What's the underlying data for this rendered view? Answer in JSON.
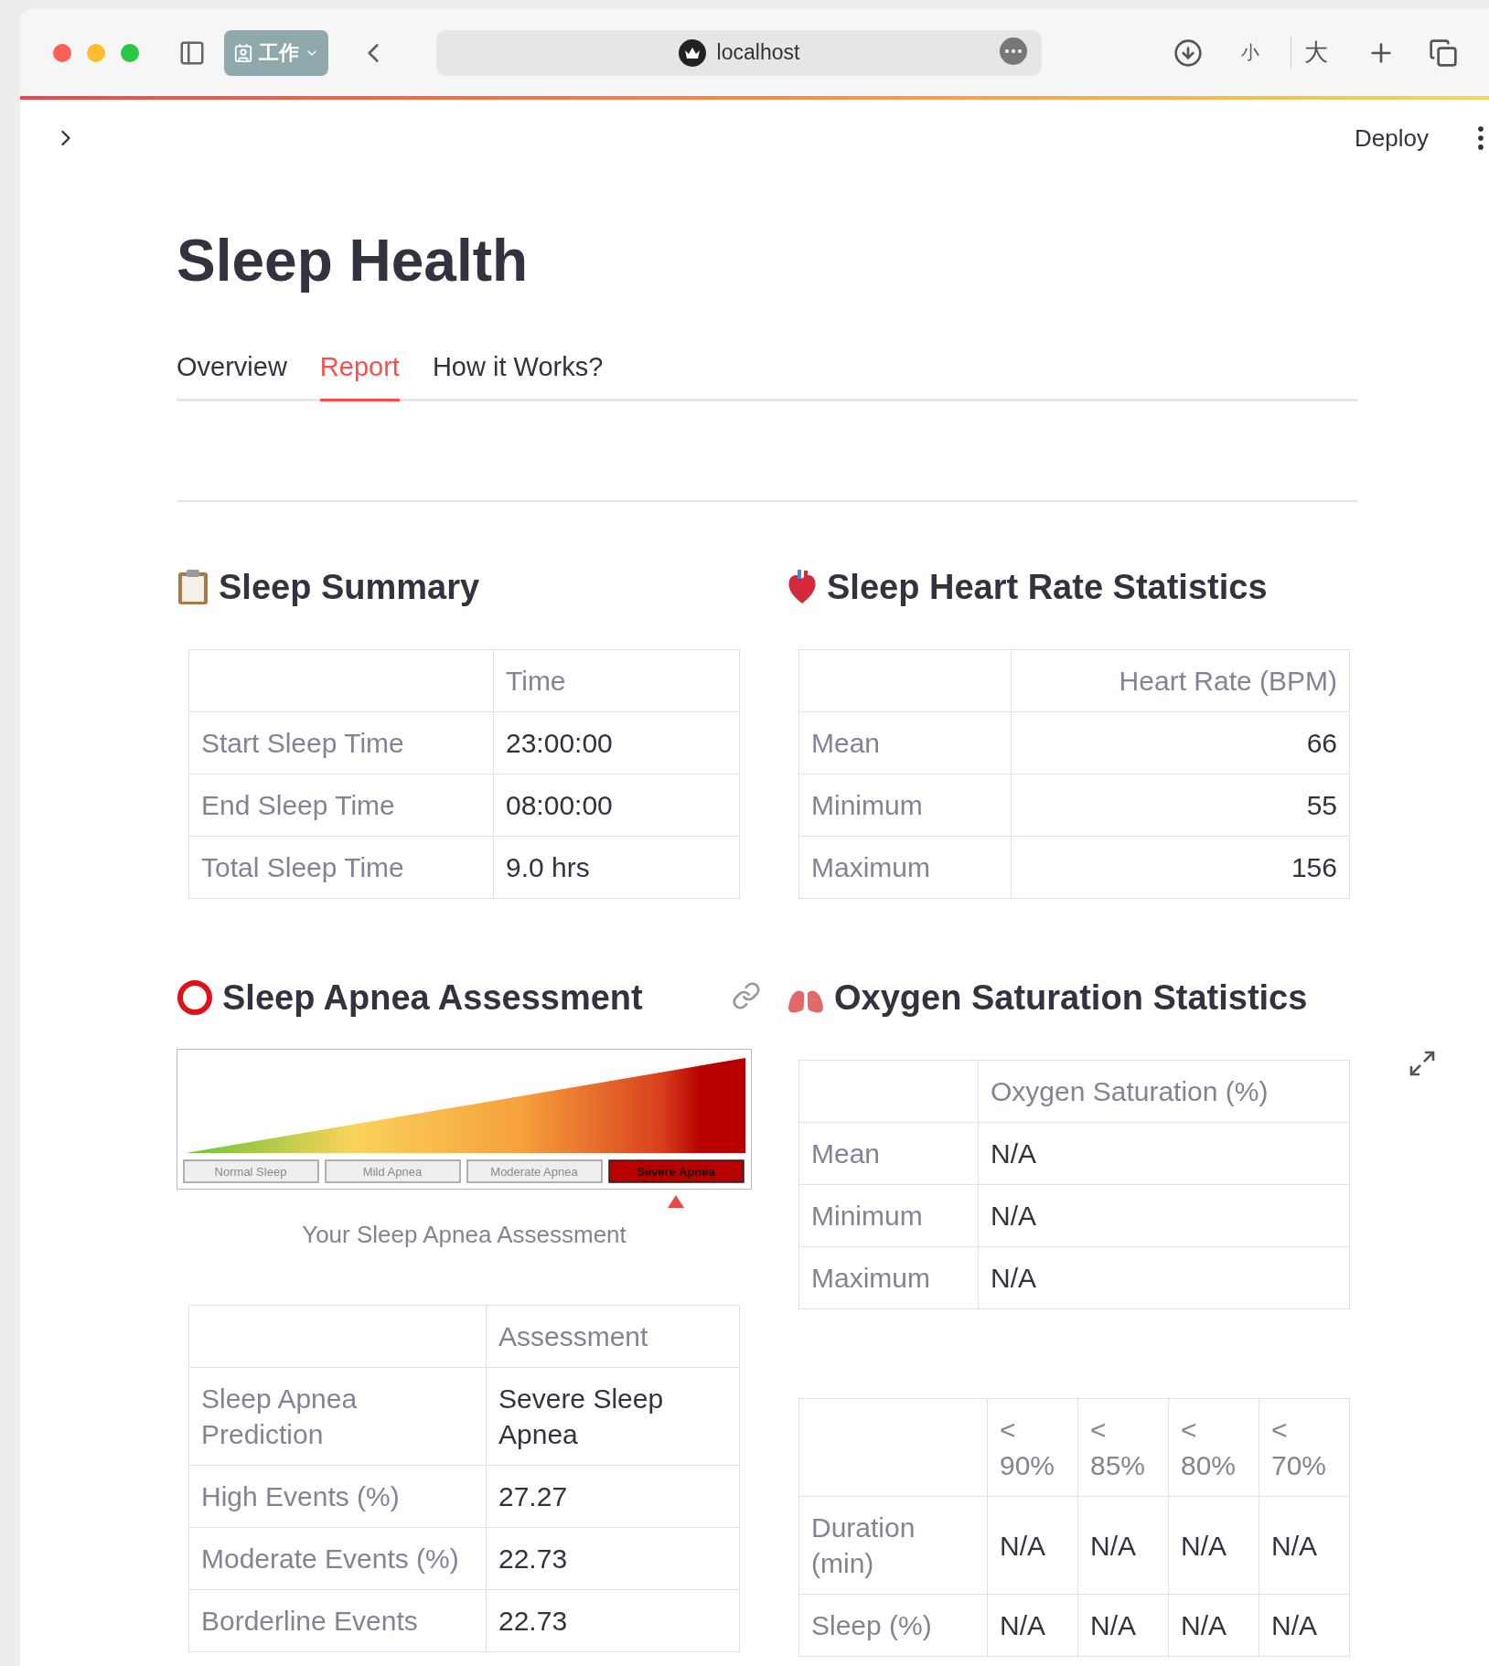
{
  "browser": {
    "tab_group": "工作",
    "address": "localhost",
    "text_smaller": "小",
    "text_larger": "大"
  },
  "header": {
    "deploy": "Deploy"
  },
  "title": "Sleep Health",
  "tabs": [
    {
      "label": "Overview",
      "selected": false
    },
    {
      "label": "Report",
      "selected": true
    },
    {
      "label": "How it Works?",
      "selected": false
    }
  ],
  "sleep_summary": {
    "title": "Sleep Summary",
    "columns": [
      "Time"
    ],
    "rows": [
      {
        "label": "Start Sleep Time",
        "values": [
          "23:00:00"
        ]
      },
      {
        "label": "End Sleep Time",
        "values": [
          "08:00:00"
        ]
      },
      {
        "label": "Total Sleep Time",
        "values": [
          "9.0 hrs"
        ]
      }
    ]
  },
  "heart_rate": {
    "title": "Sleep Heart Rate Statistics",
    "columns": [
      "Heart Rate (BPM)"
    ],
    "rows": [
      {
        "label": "Mean",
        "values": [
          "66"
        ]
      },
      {
        "label": "Minimum",
        "values": [
          "55"
        ]
      },
      {
        "label": "Maximum",
        "values": [
          "156"
        ]
      }
    ]
  },
  "apnea": {
    "title": "Sleep Apnea Assessment",
    "gauge": {
      "levels": [
        {
          "label": "Normal Sleep",
          "selected": false
        },
        {
          "label": "Mild Apnea",
          "selected": false
        },
        {
          "label": "Moderate Apnea",
          "selected": false
        },
        {
          "label": "Severe Apnea",
          "selected": true
        }
      ]
    },
    "caption": "Your Sleep Apnea Assessment",
    "columns": [
      "Assessment"
    ],
    "rows": [
      {
        "label": "Sleep Apnea Prediction",
        "values": [
          "Severe Sleep Apnea"
        ]
      },
      {
        "label": "High Events (%)",
        "values": [
          "27.27"
        ]
      },
      {
        "label": "Moderate Events (%)",
        "values": [
          "22.73"
        ]
      },
      {
        "label": "Borderline Events",
        "values": [
          "22.73"
        ]
      }
    ]
  },
  "oxygen": {
    "title": "Oxygen Saturation Statistics",
    "columns": [
      "Oxygen Saturation (%)"
    ],
    "rows": [
      {
        "label": "Mean",
        "values": [
          "N/A"
        ]
      },
      {
        "label": "Minimum",
        "values": [
          "N/A"
        ]
      },
      {
        "label": "Maximum",
        "values": [
          "N/A"
        ]
      }
    ],
    "thresholds": {
      "columns": [
        "< 90%",
        "< 85%",
        "< 80%",
        "< 70%"
      ],
      "rows": [
        {
          "label": "Duration (min)",
          "values": [
            "N/A",
            "N/A",
            "N/A",
            "N/A"
          ]
        },
        {
          "label": "Sleep (%)",
          "values": [
            "N/A",
            "N/A",
            "N/A",
            "N/A"
          ]
        }
      ]
    }
  }
}
